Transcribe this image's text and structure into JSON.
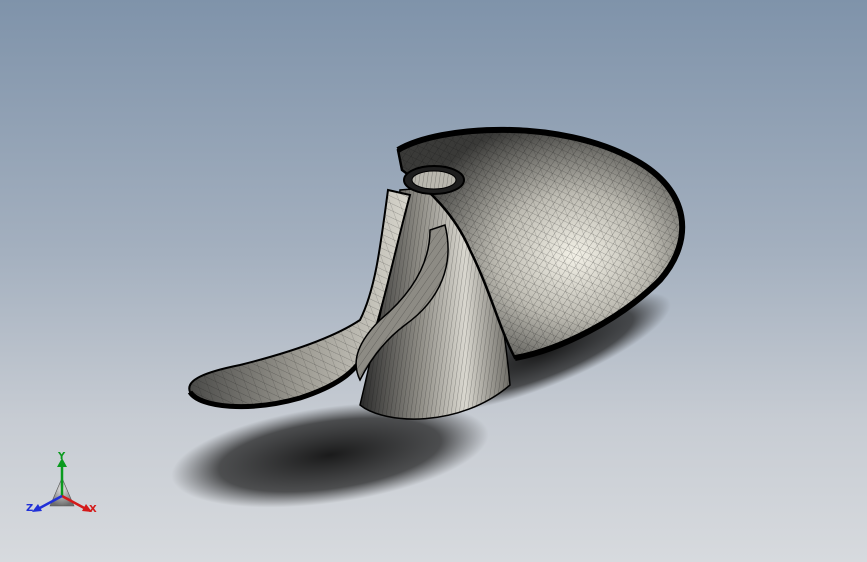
{
  "viewport": {
    "background_top": "#7f93aa",
    "background_bottom": "#d7dade",
    "display_mode": "shaded-with-edges",
    "model_subject": "propeller-mesh"
  },
  "triad": {
    "x_label": "X",
    "y_label": "Y",
    "z_label": "Z",
    "x_color": "#d41a1a",
    "y_color": "#0a9a1e",
    "z_color": "#2030d8"
  }
}
